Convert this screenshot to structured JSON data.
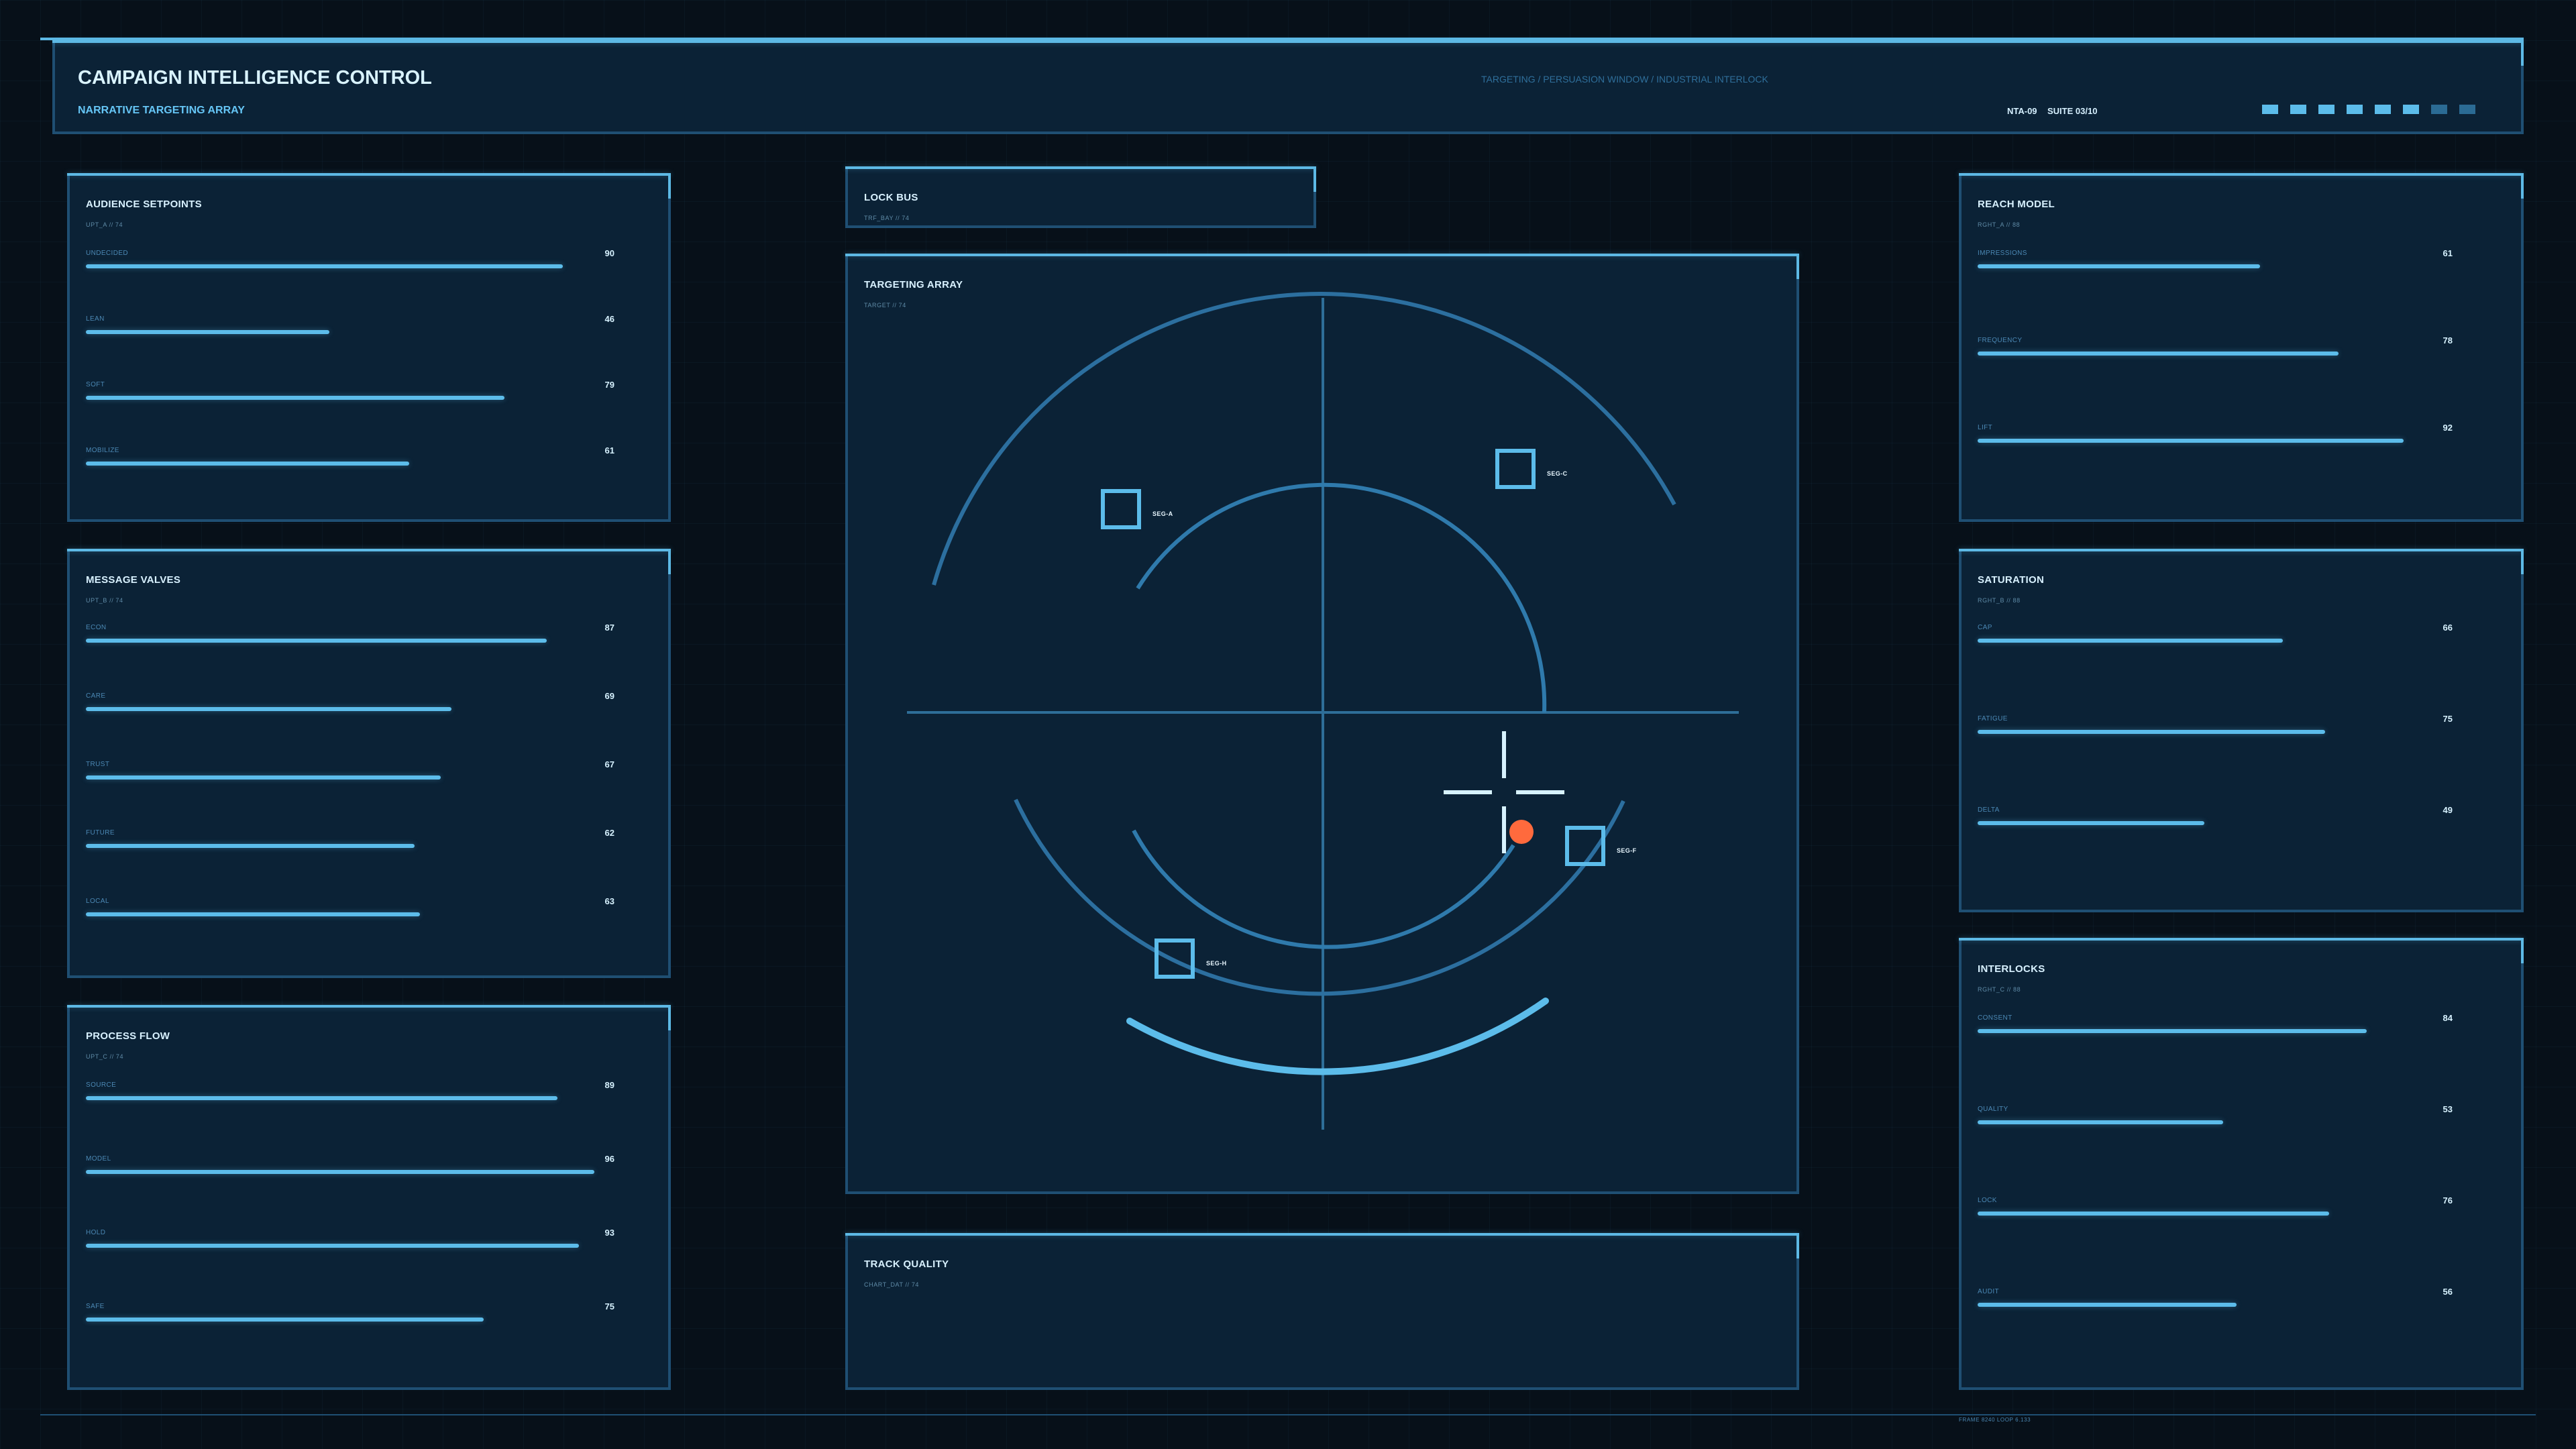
{
  "header": {
    "title": "CAMPAIGN INTELLIGENCE CONTROL",
    "subtitle": "NARRATIVE TARGETING ARRAY",
    "center_text": "TARGETING / PERSUASION WINDOW / INDUSTRIAL INTERLOCK",
    "meta_left": "NTA-09",
    "meta_right": "SUITE 03/10",
    "status_blocks": [
      "active",
      "active",
      "active",
      "active",
      "active",
      "active",
      "dim",
      "dim"
    ]
  },
  "left_panels": [
    {
      "title": "AUDIENCE SETPOINTS",
      "code": "UPT_A // 74",
      "metrics": [
        {
          "label": "UNDECIDED",
          "value": 90,
          "fill": 0.9
        },
        {
          "label": "LEAN",
          "value": 46,
          "fill": 0.46
        },
        {
          "label": "SOFT",
          "value": 79,
          "fill": 0.79
        },
        {
          "label": "MOBILIZE",
          "value": 61,
          "fill": 0.61
        }
      ]
    },
    {
      "title": "MESSAGE VALVES",
      "code": "UPT_B // 74",
      "metrics": [
        {
          "label": "ECON",
          "value": 87,
          "fill": 0.87
        },
        {
          "label": "CARE",
          "value": 69,
          "fill": 0.69
        },
        {
          "label": "TRUST",
          "value": 67,
          "fill": 0.67
        },
        {
          "label": "FUTURE",
          "value": 62,
          "fill": 0.62
        },
        {
          "label": "LOCAL",
          "value": 63,
          "fill": 0.63
        }
      ]
    },
    {
      "title": "PROCESS FLOW",
      "code": "UPT_C // 74",
      "metrics": [
        {
          "label": "SOURCE",
          "value": 89,
          "fill": 0.89
        },
        {
          "label": "MODEL",
          "value": 96,
          "fill": 0.96
        },
        {
          "label": "HOLD",
          "value": 93,
          "fill": 0.93
        },
        {
          "label": "SAFE",
          "value": 75,
          "fill": 0.75
        }
      ]
    }
  ],
  "center": {
    "lock_bus": {
      "title": "LOCK BUS",
      "code": "TRF_BAY // 74"
    },
    "targeting_array": {
      "title": "TARGETING ARRAY",
      "code": "TARGET // 74",
      "segments": [
        "SEG-A",
        "SEG-C",
        "SEG-F",
        "SEG-H"
      ]
    },
    "track_quality": {
      "title": "TRACK QUALITY",
      "code": "CHART_DAT // 74"
    }
  },
  "right_panels": [
    {
      "title": "REACH MODEL",
      "code": "RGHT_A // 88",
      "metrics": [
        {
          "label": "IMPRESSIONS",
          "value": 61,
          "fill": 0.61
        },
        {
          "label": "FREQUENCY",
          "value": 78,
          "fill": 0.78
        },
        {
          "label": "LIFT",
          "value": 92,
          "fill": 0.92
        }
      ]
    },
    {
      "title": "SATURATION",
      "code": "RGHT_B // 88",
      "metrics": [
        {
          "label": "CAP",
          "value": 66,
          "fill": 0.66
        },
        {
          "label": "FATIGUE",
          "value": 75,
          "fill": 0.75
        },
        {
          "label": "DELTA",
          "value": 49,
          "fill": 0.49
        }
      ]
    },
    {
      "title": "INTERLOCKS",
      "code": "RGHT_C // 88",
      "metrics": [
        {
          "label": "CONSENT",
          "value": 84,
          "fill": 0.84
        },
        {
          "label": "QUALITY",
          "value": 53,
          "fill": 0.53
        },
        {
          "label": "LOCK",
          "value": 76,
          "fill": 0.76
        },
        {
          "label": "AUDIT",
          "value": 56,
          "fill": 0.56
        }
      ]
    }
  ],
  "footer": {
    "text": "FRAME 8240  LOOP 6.133"
  },
  "colors": {
    "accent": "#5cbcea",
    "frame": "#1f4f73",
    "panel": "#0b2236",
    "target": "#ff6a3d"
  }
}
